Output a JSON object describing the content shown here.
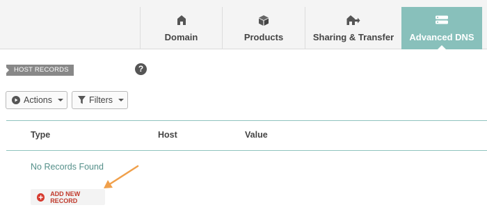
{
  "tabs": [
    {
      "label": "Domain",
      "icon": "home-icon",
      "active": false
    },
    {
      "label": "Products",
      "icon": "box-icon",
      "active": false
    },
    {
      "label": "Sharing & Transfer",
      "icon": "house-arrow-icon",
      "active": false
    },
    {
      "label": "Advanced DNS",
      "icon": "server-icon",
      "active": true
    }
  ],
  "section": {
    "title": "HOST RECORDS",
    "help_icon": "question-icon"
  },
  "toolbar": {
    "actions_label": "Actions",
    "filters_label": "Filters"
  },
  "table": {
    "columns": [
      "Type",
      "Host",
      "Value"
    ],
    "empty_text": "No Records Found"
  },
  "add_record": {
    "label": "ADD NEW RECORD"
  },
  "colors": {
    "accent": "#88c0bb",
    "rule": "#8fc3be",
    "annotation_arrow": "#f0a04b",
    "add_icon": "#d63b2f"
  }
}
